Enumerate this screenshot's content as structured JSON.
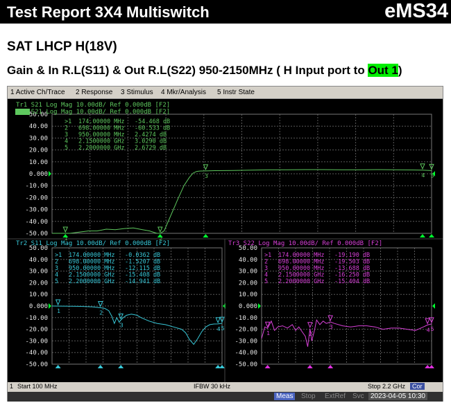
{
  "header": {
    "title": "Test Report 3X4 Multiswitch",
    "code": "eMS34"
  },
  "heading1": "SAT LHCP H(18V)",
  "heading2": {
    "before": "Gain & In R.L(S11) & Out R.L(S22) 950-2150MHz ( H Input port to ",
    "highlight": "Out 1",
    "after": ")"
  },
  "menu": [
    "1 Active Ch/Trace",
    "2 Response",
    "3 Stimulus",
    "4 Mkr/Analysis",
    "5 Instr State"
  ],
  "colors": {
    "tr1": "#5ec85e",
    "tr2": "#38c8d8",
    "tr3": "#d840d8",
    "grid": "#5a5a5a",
    "axis_text": "#e8e8e8",
    "ref_marker": "#00ff30",
    "stim_marker": "#38c8d8",
    "stim_marker_tr3": "#e030e0"
  },
  "status": {
    "channel": "1",
    "start": "Start 100 MHz",
    "ifbw": "IFBW 30 kHz",
    "stop": "Stop 2.2 GHz",
    "cor": "Cor"
  },
  "softkeys": {
    "meas": "Meas",
    "stop": "Stop",
    "extref": "ExtRef",
    "svc": "Svc",
    "datetime": "2023-04-05 10:30"
  },
  "chart_data": [
    {
      "type": "line",
      "title": "Tr1 S21 Log Mag 10.00dB/ Ref 0.000dB [F2]",
      "legend": [
        "Tr1 S21 Log Mag 10.00dB/ Ref 0.000dB [F2]",
        "Tr4 S21 Log Mag 10.00dB/ Ref 0.000dB [F2]"
      ],
      "yticks": [
        "50.00",
        "40.00",
        "30.00",
        "20.00",
        "10.00",
        "0.000",
        "-10.00",
        "-20.00",
        "-30.00",
        "-40.00",
        "-50.00"
      ],
      "ylim": [
        -50,
        50
      ],
      "xlim": [
        100,
        2200
      ],
      "x_unit": "MHz",
      "markers": [
        {
          "id": ">1",
          "freq": "174.00000 MHz",
          "value": "-54.468 dB",
          "x": 174,
          "y": -54.468
        },
        {
          "id": "2",
          "freq": "698.00000 MHz",
          "value": "-60.533 dB",
          "x": 698,
          "y": -60.533
        },
        {
          "id": "3",
          "freq": "950.00000 MHz",
          "value": "2.4274 dB",
          "x": 950,
          "y": 2.4274
        },
        {
          "id": "4",
          "freq": "2.1500000 GHz",
          "value": "3.0290 dB",
          "x": 2150,
          "y": 3.029
        },
        {
          "id": "5",
          "freq": "2.2000000 GHz",
          "value": "2.6729 dB",
          "x": 2200,
          "y": 2.6729
        }
      ],
      "series": [
        {
          "x": [
            100,
            140,
            174,
            200,
            250,
            300,
            350,
            400,
            450,
            500,
            550,
            600,
            640,
            680,
            698,
            720,
            760,
            800,
            830,
            860,
            880,
            900,
            920,
            950,
            1000,
            1100,
            1200,
            1300,
            1400,
            1500,
            1600,
            1700,
            1800,
            1900,
            2000,
            2100,
            2150,
            2200
          ],
          "y": [
            -54,
            -52,
            -53,
            -51,
            -49,
            -48,
            -48,
            -46.5,
            -47,
            -46,
            -45.5,
            -47,
            -48,
            -50,
            -53,
            -48,
            -34,
            -20,
            -10,
            -3,
            0.5,
            2,
            2.3,
            2.4,
            2.6,
            2.8,
            3.0,
            3.3,
            3.4,
            3.5,
            3.5,
            3.3,
            3.3,
            3.5,
            3.4,
            3.2,
            3.0,
            2.7
          ]
        }
      ]
    },
    {
      "type": "line",
      "title": "Tr2 S11 Log Mag 10.00dB/ Ref 0.000dB [F2]",
      "yticks": [
        "50.00",
        "40.00",
        "30.00",
        "20.00",
        "10.00",
        "0.000",
        "-10.00",
        "-20.00",
        "-30.00",
        "-40.00",
        "-50.00"
      ],
      "ylim": [
        -50,
        50
      ],
      "xlim": [
        100,
        2200
      ],
      "x_unit": "MHz",
      "markers": [
        {
          "id": ">1",
          "freq": "174.00000 MHz",
          "value": "-0.0362 dB",
          "x": 174,
          "y": -0.0362
        },
        {
          "id": "2",
          "freq": "698.00000 MHz",
          "value": "-1.5207 dB",
          "x": 698,
          "y": -1.5207
        },
        {
          "id": "3",
          "freq": "950.00000 MHz",
          "value": "-12.115 dB",
          "x": 950,
          "y": -12.115
        },
        {
          "id": "4",
          "freq": "2.1500000 GHz",
          "value": "-15.408 dB",
          "x": 2150,
          "y": -15.408
        },
        {
          "id": "5",
          "freq": "2.2000000 GHz",
          "value": "-14.941 dB",
          "x": 2200,
          "y": -14.941
        }
      ],
      "series": [
        {
          "x": [
            100,
            174,
            300,
            450,
            600,
            698,
            750,
            800,
            840,
            870,
            900,
            930,
            950,
            980,
            1020,
            1080,
            1150,
            1200,
            1300,
            1400,
            1500,
            1600,
            1700,
            1750,
            1800,
            1850,
            1900,
            1950,
            2000,
            2050,
            2100,
            2150,
            2200
          ],
          "y": [
            0,
            -0.04,
            -0.1,
            -0.3,
            -0.8,
            -1.5,
            -2,
            -4,
            -9,
            -15,
            -10,
            -14,
            -12.1,
            -10,
            -8,
            -7,
            -8,
            -10,
            -13,
            -15,
            -16,
            -18,
            -20,
            -23,
            -29,
            -33,
            -28,
            -22,
            -18,
            -16,
            -15.5,
            -15.4,
            -14.9
          ]
        }
      ]
    },
    {
      "type": "line",
      "title": "Tr3 S22 Log Mag 10.00dB/ Ref 0.000dB [F2]",
      "yticks": [
        "50.00",
        "40.00",
        "30.00",
        "20.00",
        "10.00",
        "0.000",
        "-10.00",
        "-20.00",
        "-30.00",
        "-40.00",
        "-50.00"
      ],
      "ylim": [
        -50,
        50
      ],
      "xlim": [
        100,
        2200
      ],
      "x_unit": "MHz",
      "markers": [
        {
          "id": ">1",
          "freq": "174.00000 MHz",
          "value": "-19.190 dB",
          "x": 174,
          "y": -19.19
        },
        {
          "id": "2",
          "freq": "698.00000 MHz",
          "value": "-19.503 dB",
          "x": 698,
          "y": -19.503
        },
        {
          "id": "3",
          "freq": "950.00000 MHz",
          "value": "-13.688 dB",
          "x": 950,
          "y": -13.688
        },
        {
          "id": "4",
          "freq": "2.1500000 GHz",
          "value": "-16.250 dB",
          "x": 2150,
          "y": -16.25
        },
        {
          "id": "5",
          "freq": "2.2000000 GHz",
          "value": "-15.404 dB",
          "x": 2200,
          "y": -15.404
        }
      ],
      "series": [
        {
          "x": [
            100,
            140,
            174,
            220,
            260,
            300,
            360,
            420,
            480,
            520,
            560,
            600,
            640,
            670,
            698,
            720,
            750,
            780,
            820,
            860,
            900,
            950,
            1000,
            1100,
            1200,
            1300,
            1400,
            1500,
            1600,
            1700,
            1800,
            1900,
            2000,
            2100,
            2150,
            2200
          ],
          "y": [
            -28,
            -18,
            -19.2,
            -13,
            -21,
            -18,
            -17,
            -19,
            -16,
            -21,
            -18,
            -22,
            -26,
            -35,
            -19.5,
            -30,
            -22,
            -12,
            -16,
            -13,
            -15,
            -13.7,
            -15,
            -17,
            -18,
            -17,
            -17,
            -18,
            -20,
            -19,
            -19,
            -20,
            -21,
            -18,
            -16.3,
            -15.4
          ]
        }
      ]
    }
  ]
}
